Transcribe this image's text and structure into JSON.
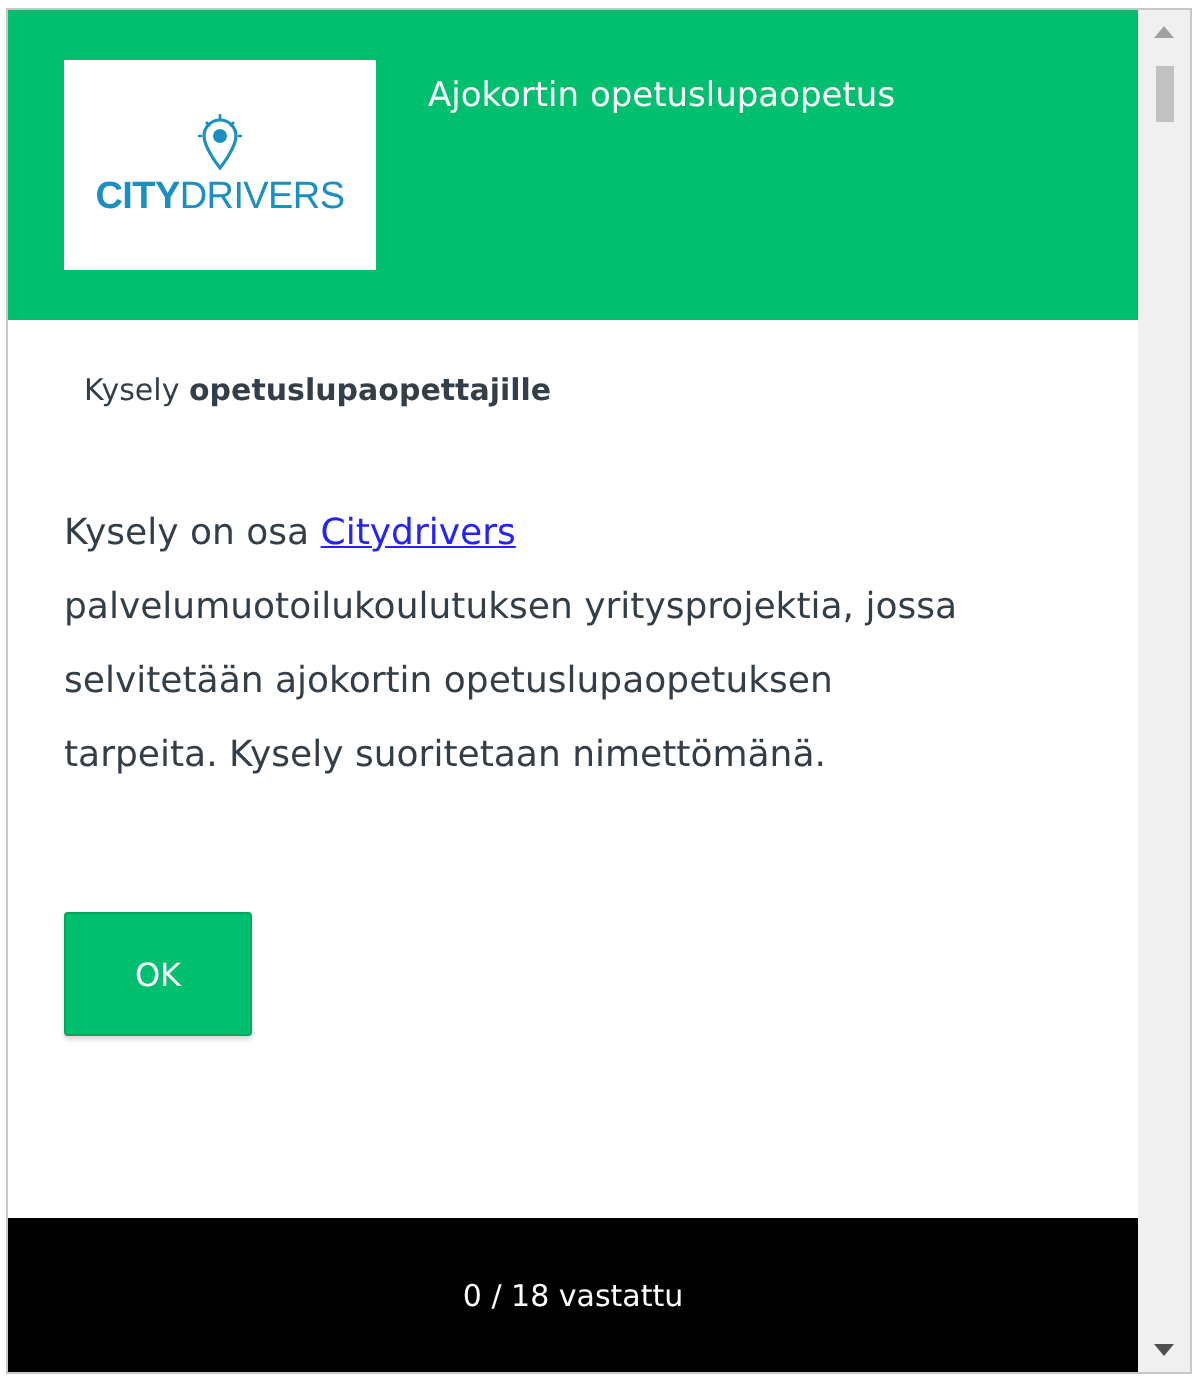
{
  "header": {
    "logo": {
      "bold": "CITY",
      "light": "DRIVERS"
    },
    "title": "Ajokortin opetuslupaopetus"
  },
  "subtitle": "Kysely **opetuslupaopettajille**",
  "intro": {
    "before": "Kysely on osa",
    "link": "Citydrivers",
    "after": "palvelumuotoilukoulutuksen yritysprojektia, jossa selvitetään ajokortin opetuslupaopetuksen tarpeita. Kysely suoritetaan nimettömänä."
  },
  "button": "OK",
  "progress": "0 / 18 vastattu"
}
